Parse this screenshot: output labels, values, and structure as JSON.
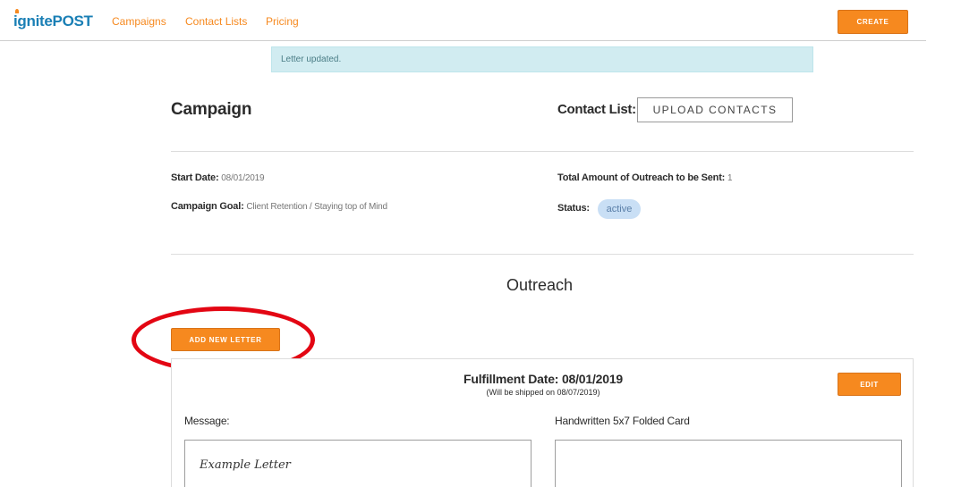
{
  "nav": {
    "logo_part1": "ignite",
    "logo_part2": "POST",
    "links": [
      "Campaigns",
      "Contact Lists",
      "Pricing"
    ],
    "create_label": "CREATE"
  },
  "alert": {
    "text": "Letter updated."
  },
  "campaign": {
    "title": "Campaign",
    "contact_list_label": "Contact List:",
    "upload_label": "UPLOAD CONTACTS",
    "start_date_label": "Start Date:",
    "start_date_value": "08/01/2019",
    "goal_label": "Campaign Goal:",
    "goal_value": "Client Retention / Staying top of Mind",
    "total_label": "Total Amount of Outreach to be Sent:",
    "total_value": "1",
    "status_label": "Status:",
    "status_value": "active"
  },
  "outreach": {
    "title": "Outreach",
    "add_label": "ADD NEW LETTER",
    "letter": {
      "fulfillment": "Fulfillment Date: 08/01/2019",
      "ship_note": "(Will be shipped on 08/07/2019)",
      "edit_label": "EDIT",
      "message_label": "Message:",
      "message_text": "Example Letter",
      "card_label": "Handwritten 5x7 Folded Card"
    }
  },
  "colors": {
    "accent": "#f6891f",
    "brand": "#1a7fb5",
    "alert_bg": "#d1ecf1",
    "highlight_circle": "#e30613"
  }
}
